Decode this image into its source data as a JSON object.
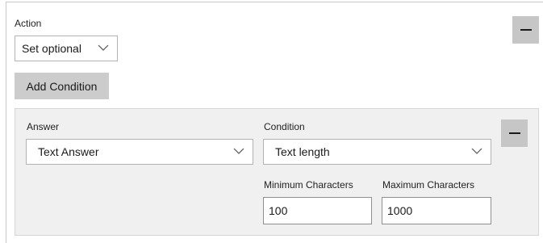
{
  "action": {
    "label": "Action",
    "selected": "Set optional"
  },
  "add_condition_label": "Add Condition",
  "remove_action_symbol": "—",
  "condition_panel": {
    "answer_label": "Answer",
    "answer_selected": "Text Answer",
    "condition_label": "Condition",
    "condition_selected": "Text length",
    "min_label": "Minimum Characters",
    "min_value": "100",
    "max_label": "Maximum Characters",
    "max_value": "1000",
    "remove_symbol": "—"
  },
  "icons": {
    "dropdown": "chevron-down-icon",
    "remove": "minus-icon"
  },
  "colors": {
    "button_gray": "#cccccc",
    "panel_bg": "#f0f0f0",
    "border": "#b3b3b3"
  }
}
